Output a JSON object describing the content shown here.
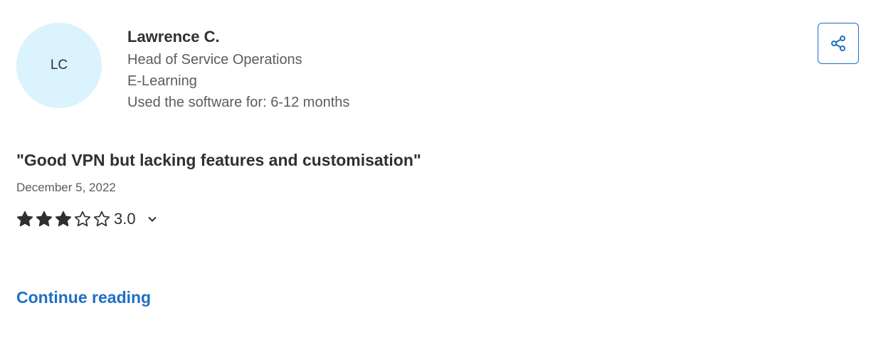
{
  "reviewer": {
    "initials": "LC",
    "name": "Lawrence C.",
    "job_title": "Head of Service Operations",
    "industry": "E-Learning",
    "usage": "Used the software for: 6-12 months"
  },
  "review": {
    "title": "\"Good VPN but lacking features and customisation\"",
    "date": "December 5, 2022",
    "rating_value": "3.0",
    "rating_filled_stars": 3,
    "rating_max_stars": 5
  },
  "actions": {
    "continue_label": "Continue reading"
  },
  "icons": {
    "share": "share-icon",
    "rating_expand": "chevron-down-icon",
    "star_filled": "star-filled-icon",
    "star_empty": "star-empty-icon"
  },
  "colors": {
    "accent": "#1f6fc5",
    "avatar_bg": "#daf3fc",
    "text_primary": "#2f3033",
    "text_secondary": "#5b5d61"
  }
}
